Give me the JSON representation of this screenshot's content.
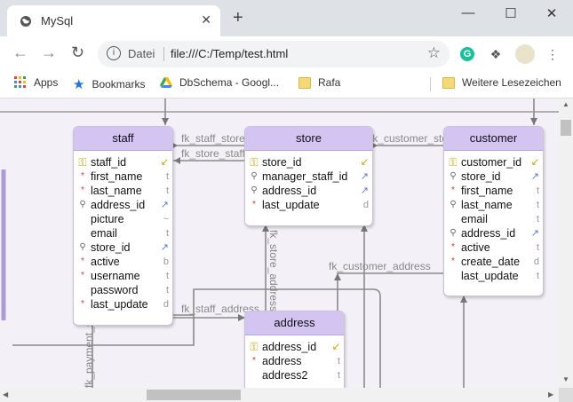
{
  "browser": {
    "tab_title": "MySql",
    "tab_close": "✕",
    "new_tab": "+",
    "minimize": "—",
    "maximize": "☐",
    "close": "✕",
    "security_label": "Datei",
    "url": "file:///C:/Temp/test.html",
    "bookmarks": [
      "Apps",
      "Bookmarks",
      "DbSchema - Googl...",
      "Rafa",
      "Weitere Lesezeichen"
    ]
  },
  "entities": {
    "staff": {
      "title": "staff",
      "columns": [
        {
          "name": "staff_id",
          "mark": "pk",
          "type": "k"
        },
        {
          "name": "first_name",
          "mark": "nn",
          "type": "t"
        },
        {
          "name": "last_name",
          "mark": "nn",
          "type": "t"
        },
        {
          "name": "address_id",
          "mark": "fk",
          "type": "a"
        },
        {
          "name": "picture",
          "mark": "",
          "type": "~"
        },
        {
          "name": "email",
          "mark": "",
          "type": "t"
        },
        {
          "name": "store_id",
          "mark": "fk",
          "type": "a"
        },
        {
          "name": "active",
          "mark": "nn",
          "type": "b"
        },
        {
          "name": "username",
          "mark": "nn",
          "type": "t"
        },
        {
          "name": "password",
          "mark": "",
          "type": "t"
        },
        {
          "name": "last_update",
          "mark": "nn",
          "type": "d"
        }
      ]
    },
    "store": {
      "title": "store",
      "columns": [
        {
          "name": "store_id",
          "mark": "pk",
          "type": "k"
        },
        {
          "name": "manager_staff_id",
          "mark": "fk",
          "type": "a"
        },
        {
          "name": "address_id",
          "mark": "fk",
          "type": "a"
        },
        {
          "name": "last_update",
          "mark": "nn",
          "type": "d"
        }
      ]
    },
    "customer": {
      "title": "customer",
      "columns": [
        {
          "name": "customer_id",
          "mark": "pk",
          "type": "k"
        },
        {
          "name": "store_id",
          "mark": "fk",
          "type": "a"
        },
        {
          "name": "first_name",
          "mark": "nn",
          "type": "t"
        },
        {
          "name": "last_name",
          "mark": "fk",
          "type": "t"
        },
        {
          "name": "email",
          "mark": "",
          "type": "t"
        },
        {
          "name": "address_id",
          "mark": "fk",
          "type": "a"
        },
        {
          "name": "active",
          "mark": "nn",
          "type": "t"
        },
        {
          "name": "create_date",
          "mark": "nn",
          "type": "d"
        },
        {
          "name": "last_update",
          "mark": "",
          "type": "t"
        }
      ]
    },
    "address": {
      "title": "address",
      "columns": [
        {
          "name": "address_id",
          "mark": "pk",
          "type": "k"
        },
        {
          "name": "address",
          "mark": "nn",
          "type": "t"
        },
        {
          "name": "address2",
          "mark": "",
          "type": "t"
        }
      ]
    }
  },
  "relations": {
    "fk_staff_store": "fk_staff_store",
    "fk_store_staff": "fk_store_staff",
    "fk_customer_store": "fk_customer_store",
    "fk_store_address": "fk_store_address",
    "fk_customer_address": "fk_customer_address",
    "fk_staff_address": "fk_staff_address",
    "fk_payment_staff": "fk_payment_staff"
  }
}
